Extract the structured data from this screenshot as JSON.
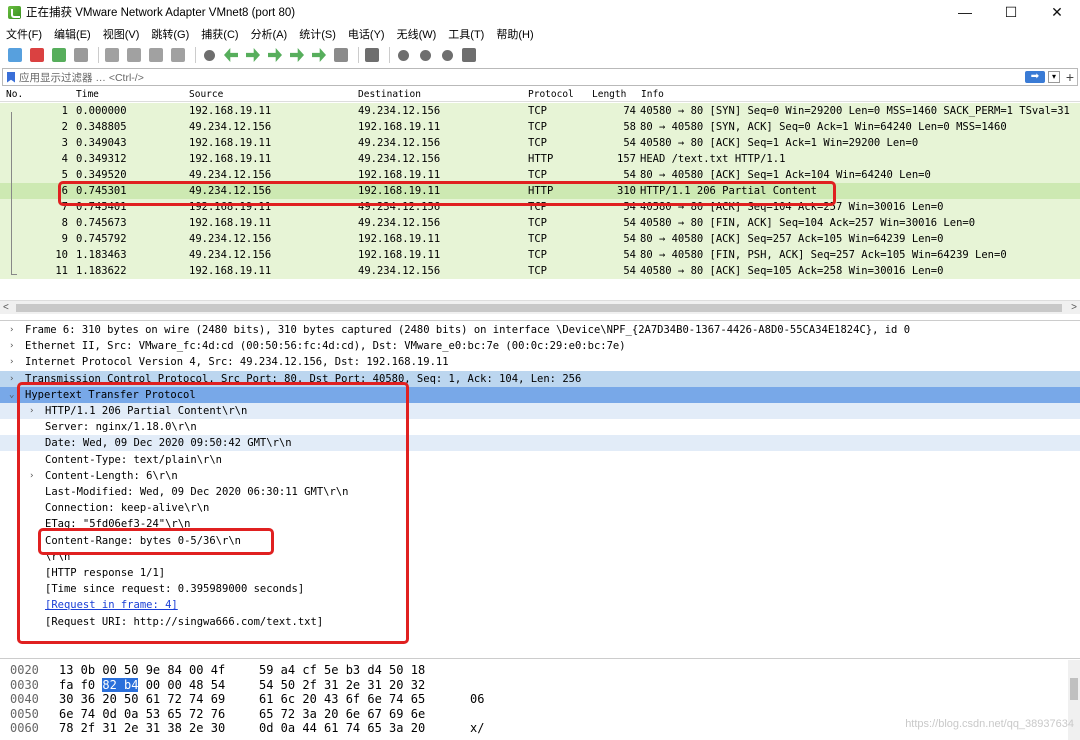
{
  "window": {
    "title": "正在捕获 VMware Network Adapter VMnet8 (port 80)",
    "controls": {
      "minimize": "—",
      "maximize": "☐",
      "close": "✕"
    }
  },
  "menu": [
    "文件(F)",
    "编辑(E)",
    "视图(V)",
    "跳转(G)",
    "捕获(C)",
    "分析(A)",
    "统计(S)",
    "电话(Y)",
    "无线(W)",
    "工具(T)",
    "帮助(H)"
  ],
  "toolbar_icons": [
    {
      "name": "shark-fin-icon",
      "color": "#3a8fd8"
    },
    {
      "name": "stop-icon",
      "color": "#d42020"
    },
    {
      "name": "restart-icon",
      "color": "#3aa040"
    },
    {
      "name": "options-gear-icon",
      "color": "#888888"
    },
    {
      "name": "open-file-icon",
      "color": "#909090"
    },
    {
      "name": "save-file-icon",
      "color": "#909090"
    },
    {
      "name": "close-file-icon",
      "color": "#909090"
    },
    {
      "name": "reload-icon",
      "color": "#909090"
    },
    {
      "name": "find-icon",
      "color": "#555555"
    },
    {
      "name": "back-arrow-icon",
      "color": "#3aa040"
    },
    {
      "name": "forward-arrow-icon",
      "color": "#3aa040"
    },
    {
      "name": "goto-packet-icon",
      "color": "#3aa040"
    },
    {
      "name": "first-packet-icon",
      "color": "#3aa040"
    },
    {
      "name": "last-packet-icon",
      "color": "#3aa040"
    },
    {
      "name": "autoscroll-icon",
      "color": "#777777"
    },
    {
      "name": "colorize-icon",
      "color": "#555555"
    },
    {
      "name": "zoom-in-icon",
      "color": "#555555"
    },
    {
      "name": "zoom-out-icon",
      "color": "#555555"
    },
    {
      "name": "zoom-reset-icon",
      "color": "#555555"
    },
    {
      "name": "resize-columns-icon",
      "color": "#555555"
    }
  ],
  "filter": {
    "placeholder": "应用显示过滤器 … <Ctrl-/>",
    "apply_label": "➡",
    "dropdown_label": "▾",
    "add_label": "+"
  },
  "packet_list": {
    "columns": [
      "No.",
      "Time",
      "Source",
      "Destination",
      "Protocol",
      "Length",
      "Info"
    ],
    "rows": [
      {
        "no": "1",
        "time": "0.000000",
        "src": "192.168.19.11",
        "dst": "49.234.12.156",
        "proto": "TCP",
        "len": "74",
        "info": "40580 → 80 [SYN] Seq=0 Win=29200 Len=0 MSS=1460 SACK_PERM=1 TSval=31",
        "bg": "#e7f4d6"
      },
      {
        "no": "2",
        "time": "0.348805",
        "src": "49.234.12.156",
        "dst": "192.168.19.11",
        "proto": "TCP",
        "len": "58",
        "info": "80 → 40580 [SYN, ACK] Seq=0 Ack=1 Win=64240 Len=0 MSS=1460",
        "bg": "#e7f4d6"
      },
      {
        "no": "3",
        "time": "0.349043",
        "src": "192.168.19.11",
        "dst": "49.234.12.156",
        "proto": "TCP",
        "len": "54",
        "info": "40580 → 80 [ACK] Seq=1 Ack=1 Win=29200 Len=0",
        "bg": "#e7f4d6"
      },
      {
        "no": "4",
        "time": "0.349312",
        "src": "192.168.19.11",
        "dst": "49.234.12.156",
        "proto": "HTTP",
        "len": "157",
        "info": "HEAD /text.txt HTTP/1.1",
        "bg": "#e7f4d6"
      },
      {
        "no": "5",
        "time": "0.349520",
        "src": "49.234.12.156",
        "dst": "192.168.19.11",
        "proto": "TCP",
        "len": "54",
        "info": "80 → 40580 [ACK] Seq=1 Ack=104 Win=64240 Len=0",
        "bg": "#e7f4d6"
      },
      {
        "no": "6",
        "time": "0.745301",
        "src": "49.234.12.156",
        "dst": "192.168.19.11",
        "proto": "HTTP",
        "len": "310",
        "info": "HTTP/1.1 206 Partial Content",
        "bg": "#cde9b2"
      },
      {
        "no": "7",
        "time": "0.745401",
        "src": "192.168.19.11",
        "dst": "49.234.12.156",
        "proto": "TCP",
        "len": "54",
        "info": "40580 → 80 [ACK] Seq=104 Ack=257 Win=30016 Len=0",
        "bg": "#e7f4d6"
      },
      {
        "no": "8",
        "time": "0.745673",
        "src": "192.168.19.11",
        "dst": "49.234.12.156",
        "proto": "TCP",
        "len": "54",
        "info": "40580 → 80 [FIN, ACK] Seq=104 Ack=257 Win=30016 Len=0",
        "bg": "#e7f4d6"
      },
      {
        "no": "9",
        "time": "0.745792",
        "src": "49.234.12.156",
        "dst": "192.168.19.11",
        "proto": "TCP",
        "len": "54",
        "info": "80 → 40580 [ACK] Seq=257 Ack=105 Win=64239 Len=0",
        "bg": "#e7f4d6"
      },
      {
        "no": "10",
        "time": "1.183463",
        "src": "49.234.12.156",
        "dst": "192.168.19.11",
        "proto": "TCP",
        "len": "54",
        "info": "80 → 40580 [FIN, PSH, ACK] Seq=257 Ack=105 Win=64239 Len=0",
        "bg": "#e7f4d6"
      },
      {
        "no": "11",
        "time": "1.183622",
        "src": "192.168.19.11",
        "dst": "49.234.12.156",
        "proto": "TCP",
        "len": "54",
        "info": "40580 → 80 [ACK] Seq=105 Ack=258 Win=30016 Len=0",
        "bg": "#e7f4d6"
      }
    ]
  },
  "scroll": {
    "left": "<",
    "right": ">"
  },
  "details": [
    {
      "indent": 0,
      "arrow": ">",
      "text": "Frame 6: 310 bytes on wire (2480 bits), 310 bytes captured (2480 bits) on interface \\Device\\NPF_{2A7D34B0-1367-4426-A8D0-55CA34E1824C}, id 0",
      "style": ""
    },
    {
      "indent": 0,
      "arrow": ">",
      "text": "Ethernet II, Src: VMware_fc:4d:cd (00:50:56:fc:4d:cd), Dst: VMware_e0:bc:7e (00:0c:29:e0:bc:7e)",
      "style": ""
    },
    {
      "indent": 0,
      "arrow": ">",
      "text": "Internet Protocol Version 4, Src: 49.234.12.156, Dst: 192.168.19.11",
      "style": ""
    },
    {
      "indent": 0,
      "arrow": ">",
      "text": "Transmission Control Protocol, Src Port: 80, Dst Port: 40580, Seq: 1, Ack: 104, Len: 256",
      "style": "tcp"
    },
    {
      "indent": 0,
      "arrow": "v",
      "text": "Hypertext Transfer Protocol",
      "style": "selected"
    },
    {
      "indent": 1,
      "arrow": ">",
      "text": "HTTP/1.1 206 Partial Content\\r\\n",
      "style": "sub"
    },
    {
      "indent": 1,
      "arrow": "",
      "text": "Server: nginx/1.18.0\\r\\n",
      "style": ""
    },
    {
      "indent": 1,
      "arrow": "",
      "text": "Date: Wed, 09 Dec 2020 09:50:42 GMT\\r\\n",
      "style": "sub"
    },
    {
      "indent": 1,
      "arrow": "",
      "text": "Content-Type: text/plain\\r\\n",
      "style": ""
    },
    {
      "indent": 1,
      "arrow": ">",
      "text": "Content-Length: 6\\r\\n",
      "style": ""
    },
    {
      "indent": 1,
      "arrow": "",
      "text": "Last-Modified: Wed, 09 Dec 2020 06:30:11 GMT\\r\\n",
      "style": ""
    },
    {
      "indent": 1,
      "arrow": "",
      "text": "Connection: keep-alive\\r\\n",
      "style": ""
    },
    {
      "indent": 1,
      "arrow": "",
      "text": "ETag: \"5fd06ef3-24\"\\r\\n",
      "style": ""
    },
    {
      "indent": 1,
      "arrow": "",
      "text": "Content-Range: bytes 0-5/36\\r\\n",
      "style": ""
    },
    {
      "indent": 1,
      "arrow": "",
      "text": "\\r\\n",
      "style": ""
    },
    {
      "indent": 1,
      "arrow": "",
      "text": "[HTTP response 1/1]",
      "style": ""
    },
    {
      "indent": 1,
      "arrow": "",
      "text": "[Time since request: 0.395989000 seconds]",
      "style": ""
    },
    {
      "indent": 1,
      "arrow": "",
      "text": "[Request in frame: 4]",
      "style": "link"
    },
    {
      "indent": 1,
      "arrow": "",
      "text": "[Request URI: http://singwa666.com/text.txt]",
      "style": ""
    }
  ],
  "bytes": [
    {
      "off": "0020",
      "hex1": "13 0b 00 50 9e 84 00 4f",
      "hex2": "59 a4 cf 5e b3 d4 50 18",
      "ascii": ""
    },
    {
      "off": "0030",
      "hex1": "fa f0 82 b4 00 00 48 54",
      "hex2": "54 50 2f 31 2e 31 20 32",
      "ascii": ""
    },
    {
      "off": "0040",
      "hex1": "30 36 20 50 61 72 74 69",
      "hex2": "61 6c 20 43 6f 6e 74 65",
      "ascii": "06"
    },
    {
      "off": "0050",
      "hex1": "6e 74 0d 0a 53 65 72 76",
      "hex2": "65 72 3a 20 6e 67 69 6e",
      "ascii": ""
    },
    {
      "off": "0060",
      "hex1": "78 2f 31 2e 31 38 2e 30",
      "hex2": "0d 0a 44 61 74 65 3a 20",
      "ascii": "x/"
    }
  ],
  "highlight_bytes": "82 b4",
  "watermark": "https://blog.csdn.net/qq_38937634"
}
